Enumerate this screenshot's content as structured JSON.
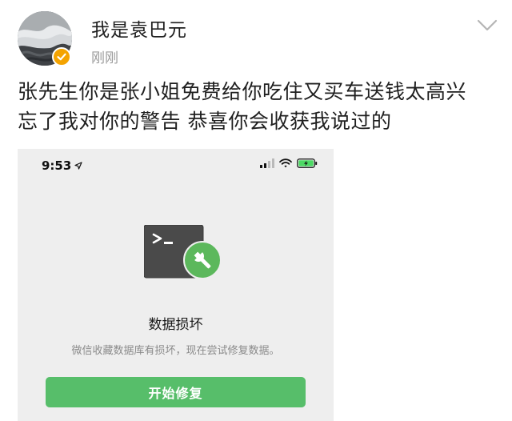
{
  "post": {
    "username": "我是袁巴元",
    "timestamp": "刚刚",
    "text_line_1": "张先生你是张小姐免费给你吃住又买车送钱太高兴",
    "text_line_2": "忘了我对你的警告 恭喜你会收获我说过的"
  },
  "screenshot": {
    "status_time": "9:53",
    "title": "数据损坏",
    "description": "微信收藏数据库有损坏，现在尝试修复数据。",
    "button_label": "开始修复"
  },
  "icons": {
    "avatar": "avatar-seascape",
    "verified": "verified-badge-icon",
    "more": "chevron-down-icon",
    "location": "location-arrow-icon",
    "signal": "signal-bars-icon",
    "wifi": "wifi-icon",
    "battery": "battery-charging-icon",
    "illustration": "terminal-wrench-icon"
  },
  "colors": {
    "verified": "#f4a300",
    "button": "#57be6a",
    "battery": "#4cd964",
    "wrench_badge": "#5cb85c"
  }
}
